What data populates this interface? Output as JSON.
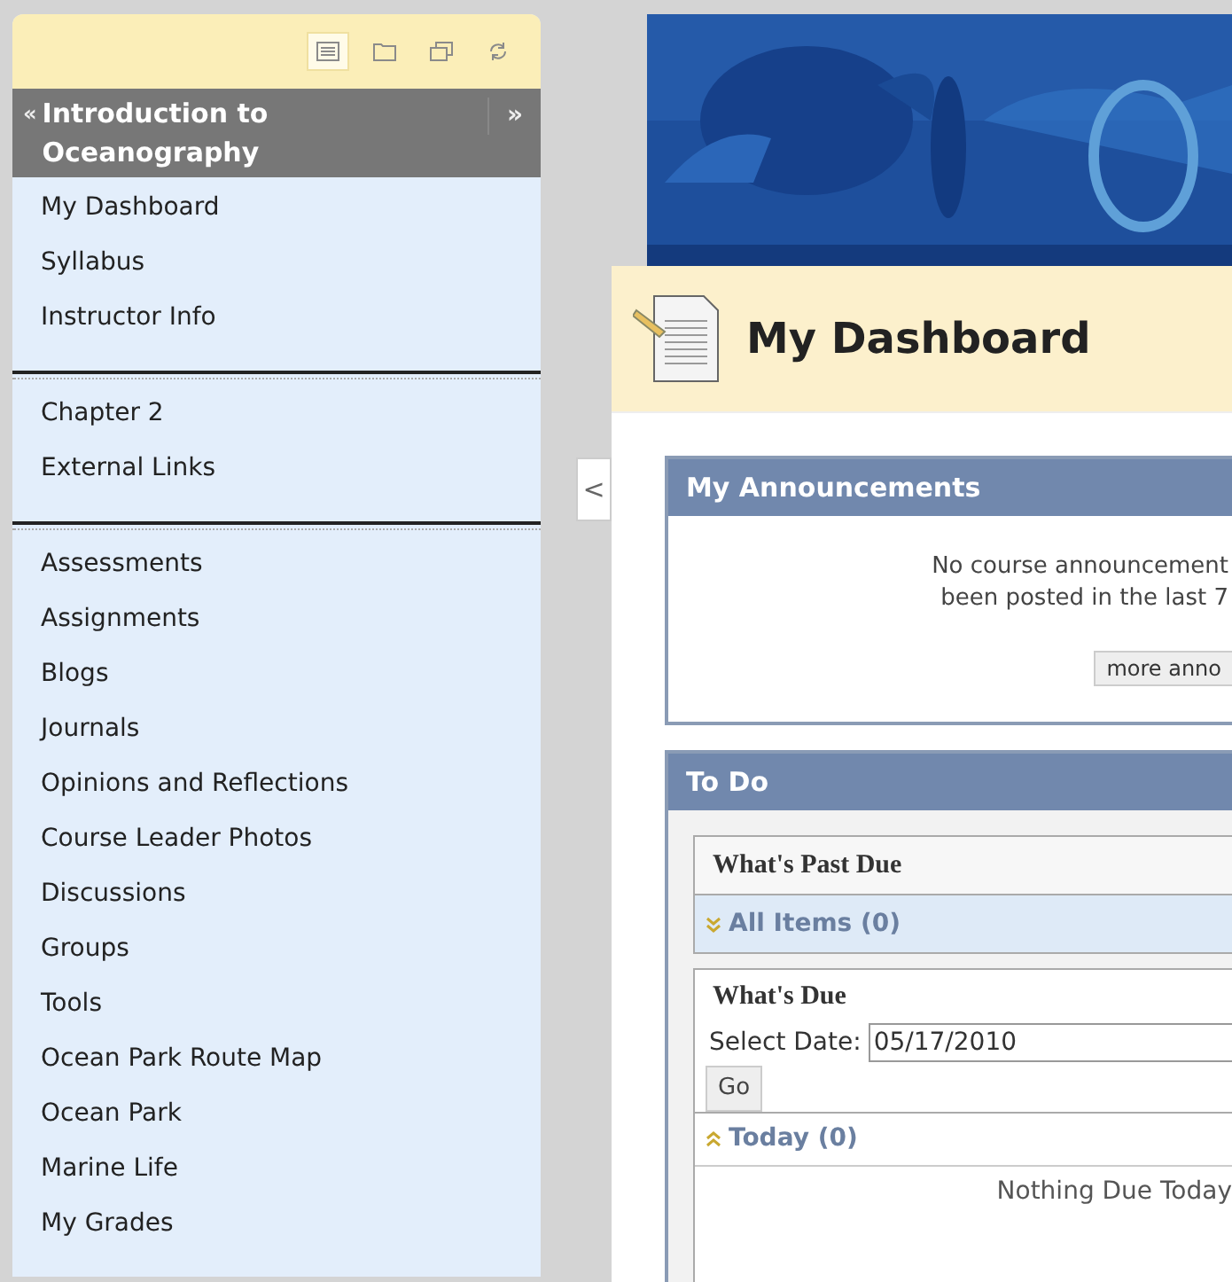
{
  "sidebar": {
    "toolbar": [
      {
        "kind": "list",
        "selected": true
      },
      {
        "kind": "folder",
        "selected": false
      },
      {
        "kind": "windows",
        "selected": false
      },
      {
        "kind": "refresh",
        "selected": false
      }
    ],
    "course_title": "Introduction to Oceanography",
    "expand_icon": "»",
    "collapse_mark": "«",
    "groups": [
      [
        "My Dashboard",
        "Syllabus",
        "Instructor Info"
      ],
      [
        "Chapter 2",
        "External Links"
      ],
      [
        "Assessments",
        "Assignments",
        "Blogs",
        "Journals",
        "Opinions and Reflections",
        "Course Leader Photos",
        "Discussions",
        "Groups",
        "Tools",
        "Ocean Park Route Map",
        "Ocean Park",
        "Marine Life",
        "My Grades"
      ]
    ]
  },
  "collapse_button": "<",
  "page_title": "My Dashboard",
  "announcements": {
    "title": "My Announcements",
    "message_lines": [
      "No course announcement",
      "been posted in the last 7"
    ],
    "more_button": "more anno"
  },
  "todo": {
    "title": "To Do",
    "past_due": {
      "title": "What's Past Due",
      "filter": "All Items (0)",
      "expanded": false
    },
    "due": {
      "title": "What's Due",
      "date_label": "Select Date:",
      "date": "05/17/2010",
      "go": "Go",
      "section": "Today (0)",
      "expanded": true,
      "empty": "Nothing Due Today"
    }
  }
}
